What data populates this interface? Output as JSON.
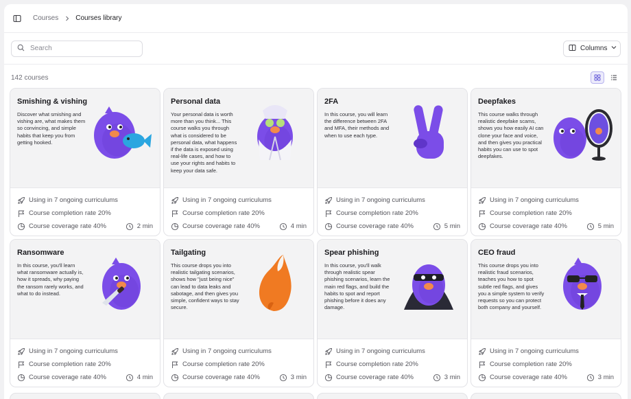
{
  "breadcrumb": {
    "parent": "Courses",
    "current": "Courses library"
  },
  "search": {
    "placeholder": "Search",
    "value": ""
  },
  "columns_button": {
    "label": "Columns"
  },
  "course_count": "142 courses",
  "view_toggle": {
    "active": "grid"
  },
  "colors": {
    "accent": "#6b5ce7",
    "mascot": "#7b4de8",
    "card_top": "#f3f3f4"
  },
  "cards": [
    {
      "title": "Smishing & vishing",
      "description": "Discover what smishing and vishing are, what makes them so convincing, and simple habits that keep you from getting hooked.",
      "illustration": "mascot-with-fish",
      "curricula": "Using in 7 ongoing curriculums",
      "completion": "Course completion rate 20%",
      "coverage": "Course coverage rate 40%",
      "duration": "2 min"
    },
    {
      "title": "Personal data",
      "description": "Your personal data is worth more than you think... This course walks you through what is considered to be personal data, what happens if the data is exposed using real-life cases, and how to use your rights and habits to keep your data safe.",
      "illustration": "mascot-in-bathrobe",
      "curricula": "Using in 7 ongoing curriculums",
      "completion": "Course completion rate 20%",
      "coverage": "Course coverage rate 40%",
      "duration": "4 min"
    },
    {
      "title": "2FA",
      "description": "In this course, you will learn the difference between 2FA and MFA, their methods and when to use each type.",
      "illustration": "peace-sign-hand",
      "curricula": "Using in 7 ongoing curriculums",
      "completion": "Course completion rate 20%",
      "coverage": "Course coverage rate 40%",
      "duration": "5 min"
    },
    {
      "title": "Deepfakes",
      "description": "This course walks through realistic deepfake scams, shows you how easily AI can clone your face and voice, and then gives you practical habits you can use to spot deepfakes.",
      "illustration": "mascot-with-mirror",
      "curricula": "Using in 7 ongoing curriculums",
      "completion": "Course completion rate 20%",
      "coverage": "Course coverage rate 40%",
      "duration": "5 min"
    },
    {
      "title": "Ransomware",
      "description": "In this course, you'll learn what ransomware actually is, how it spreads, why paying the ransom rarely works, and what to do instead.",
      "illustration": "mascot-with-knife",
      "curricula": "Using in 7 ongoing curriculums",
      "completion": "Course completion rate 20%",
      "coverage": "Course coverage rate 40%",
      "duration": "4 min"
    },
    {
      "title": "Tailgating",
      "description": "This course drops you into realistic tailgating scenarios, shows how \"just being nice\" can lead to data leaks and sabotage, and then gives you simple, confident ways to stay secure.",
      "illustration": "fox-tail",
      "curricula": "Using in 7 ongoing curriculums",
      "completion": "Course completion rate 20%",
      "coverage": "Course coverage rate 40%",
      "duration": "3 min"
    },
    {
      "title": "Spear phishing",
      "description": "In this course, you'll walk through realistic spear phishing scenarios, learn the main red flags, and build the habits to spot and report phishing before it does any damage.",
      "illustration": "masked-mascot",
      "curricula": "Using in 7 ongoing curriculums",
      "completion": "Course completion rate 20%",
      "coverage": "Course coverage rate 40%",
      "duration": "3 min"
    },
    {
      "title": "CEO fraud",
      "description": "This course drops you into realistic fraud scenarios, teaches you how to spot subtle red flags, and gives you a simple system to verify requests so you can protect both company and yourself.",
      "illustration": "mascot-ceo-sunglasses",
      "curricula": "Using in 7 ongoing curriculums",
      "completion": "Course completion rate 20%",
      "coverage": "Course coverage rate 40%",
      "duration": "3 min"
    }
  ]
}
